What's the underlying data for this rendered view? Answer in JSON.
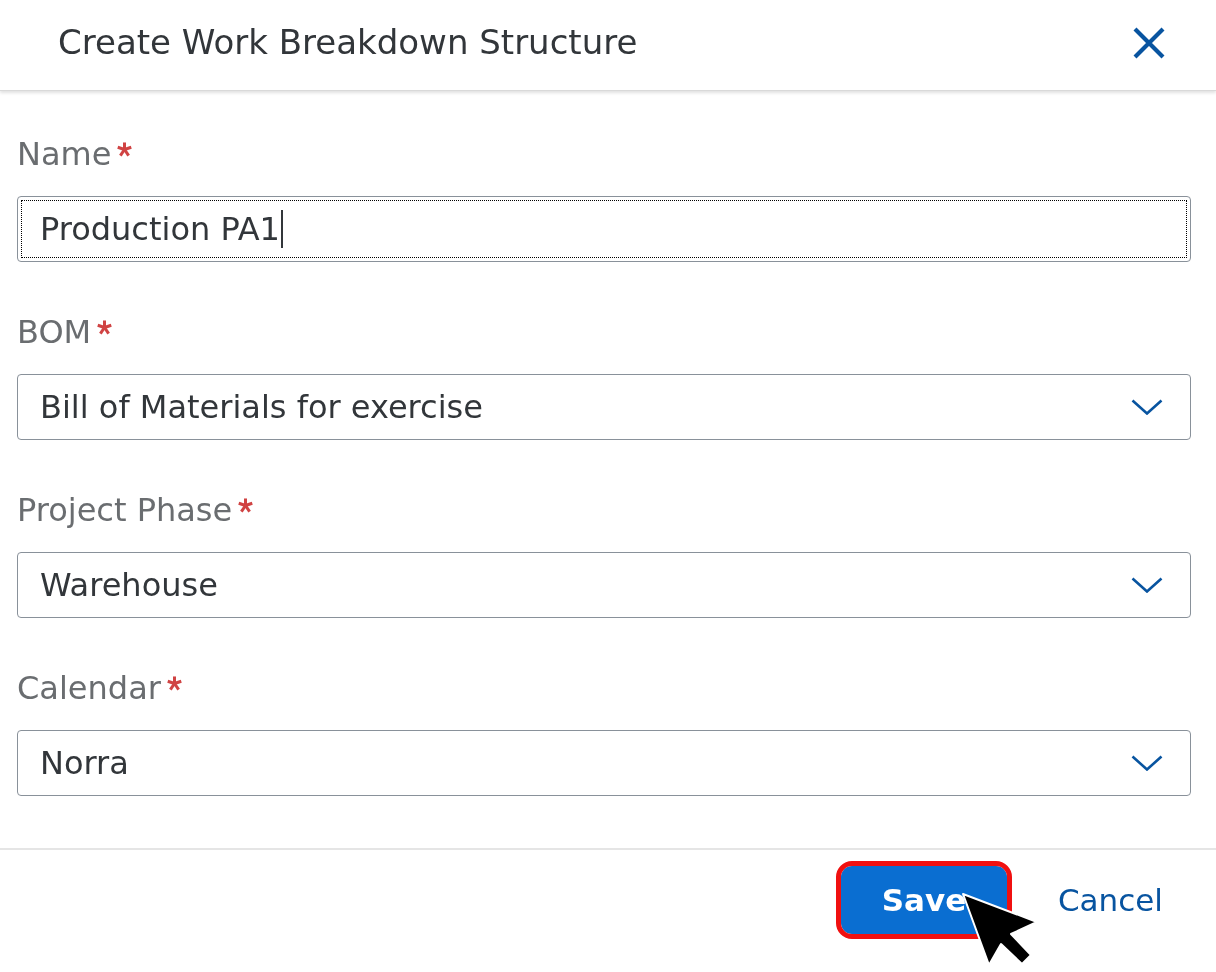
{
  "dialog": {
    "title": "Create Work Breakdown Structure"
  },
  "fields": [
    {
      "label": "Name",
      "required": true,
      "kind": "text",
      "value": "Production PA1",
      "focused": true
    },
    {
      "label": "BOM",
      "required": true,
      "kind": "select",
      "value": "Bill of Materials for exercise",
      "focused": false
    },
    {
      "label": "Project Phase",
      "required": true,
      "kind": "select",
      "value": "Warehouse",
      "focused": false
    },
    {
      "label": "Calendar",
      "required": true,
      "kind": "select",
      "value": "Norra",
      "focused": false
    }
  ],
  "footer": {
    "buttons": [
      {
        "label": "Save",
        "kind": "primary",
        "highlighted": true
      },
      {
        "label": "Cancel",
        "kind": "transparent",
        "highlighted": false
      }
    ]
  }
}
